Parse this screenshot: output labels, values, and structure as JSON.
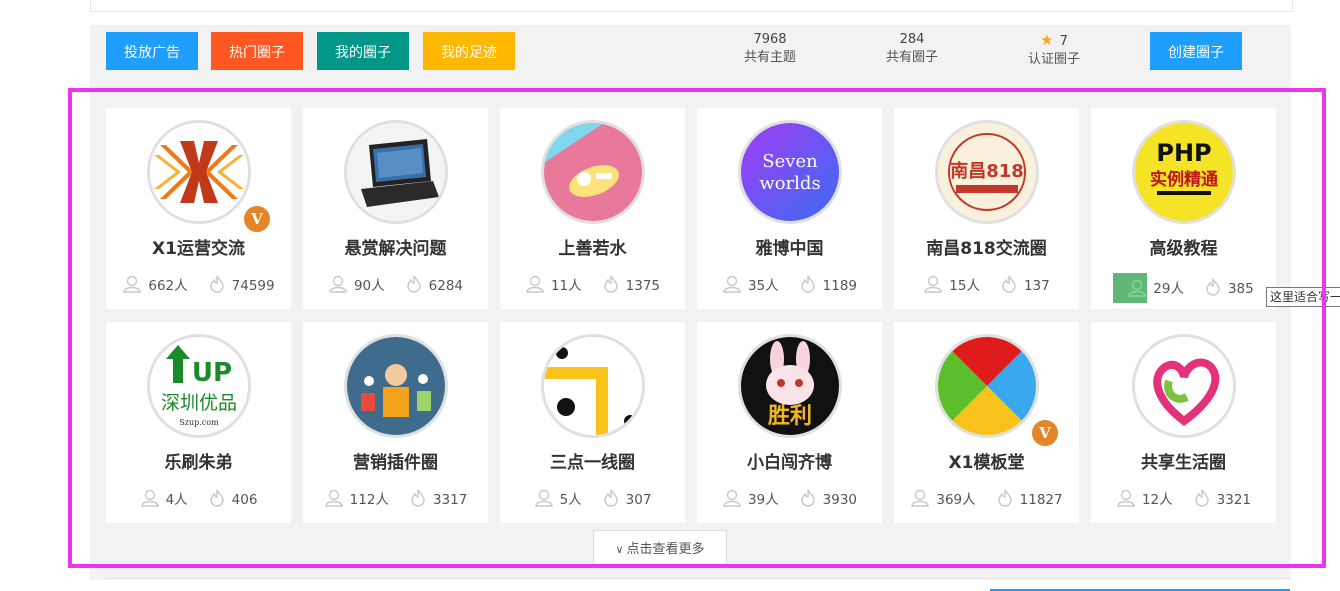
{
  "toolbar": {
    "ad_label": "投放广告",
    "hot_label": "热门圈子",
    "my_label": "我的圈子",
    "footprint_label": "我的足迹",
    "create_label": "创建圈子"
  },
  "stats": {
    "topics_num": "7968",
    "topics_label": "共有主题",
    "circles_num": "284",
    "circles_label": "共有圈子",
    "certified_num": "7",
    "certified_label": "认证圈子"
  },
  "colors": {
    "ad": "#1e9fff",
    "hot": "#ff5722",
    "my": "#009688",
    "footprint": "#ffb800",
    "create": "#1e9fff",
    "highlight": "#ee33ee",
    "v_badge": "#e3862a"
  },
  "cards": [
    {
      "name": "X1运营交流",
      "members": "662人",
      "heat": "74599",
      "verified": true,
      "avatar_icon": "x1-wings-logo"
    },
    {
      "name": "悬赏解决问题",
      "members": "90人",
      "heat": "6284",
      "verified": false,
      "avatar_icon": "laptop-photo"
    },
    {
      "name": "上善若水",
      "members": "11人",
      "heat": "1375",
      "verified": false,
      "avatar_icon": "pink-sticker"
    },
    {
      "name": "雅博中国",
      "members": "35人",
      "heat": "1189",
      "verified": false,
      "avatar_icon": "seven-worlds-logo"
    },
    {
      "name": "南昌818交流圈",
      "members": "15人",
      "heat": "137",
      "verified": false,
      "avatar_icon": "nanchang-818-logo"
    },
    {
      "name": "高级教程",
      "members": "29人",
      "heat": "385",
      "verified": false,
      "avatar_icon": "php-book-logo"
    },
    {
      "name": "乐刷朱弟",
      "members": "4人",
      "heat": "406",
      "verified": false,
      "avatar_icon": "up-shenzhen-logo"
    },
    {
      "name": "营销插件圈",
      "members": "112人",
      "heat": "3317",
      "verified": false,
      "avatar_icon": "influencer-marketing-illustration"
    },
    {
      "name": "三点一线圈",
      "members": "5人",
      "heat": "307",
      "verified": false,
      "avatar_icon": "three-dots-logo"
    },
    {
      "name": "小白闯齐博",
      "members": "39人",
      "heat": "3930",
      "verified": false,
      "avatar_icon": "rabbit-victory-logo"
    },
    {
      "name": "X1模板堂",
      "members": "369人",
      "heat": "11827",
      "verified": true,
      "avatar_icon": "color-pinwheel-logo"
    },
    {
      "name": "共享生活圈",
      "members": "12人",
      "heat": "3321",
      "verified": false,
      "avatar_icon": "heart-swirl-logo"
    }
  ],
  "more_label": "点击查看更多",
  "tooltip_text": "这里适合写一",
  "v_letter": "V",
  "avatar_text": {
    "seven_line1": "Seven",
    "seven_line2": "worlds",
    "nanchang": "南昌818",
    "php_line1": "PHP",
    "php_line2": "实例精通",
    "up": "UP",
    "shenzhen": "深圳优品",
    "szup": "Szup.com",
    "victory": "胜利"
  }
}
